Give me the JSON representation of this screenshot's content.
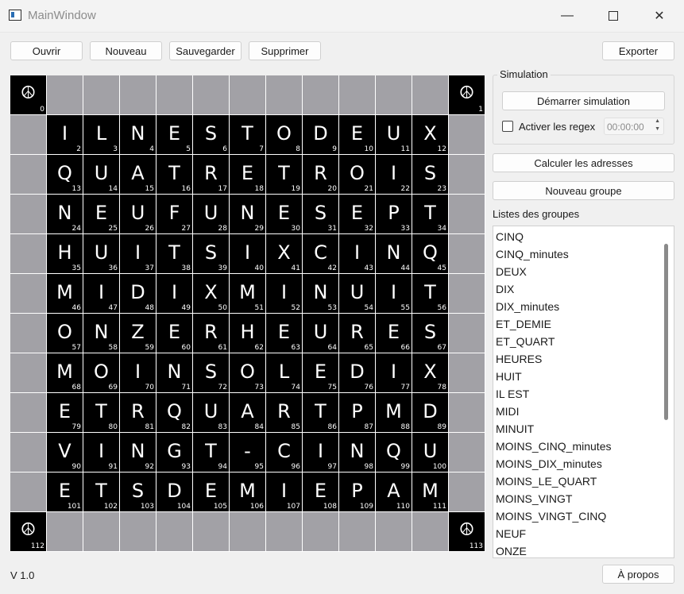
{
  "window": {
    "title": "MainWindow"
  },
  "toolbar": {
    "open_label": "Ouvrir",
    "new_label": "Nouveau",
    "save_label": "Sauvegarder",
    "delete_label": "Supprimer",
    "export_label": "Exporter"
  },
  "grid": {
    "corner_symbol": "☮",
    "corner_indices": [
      "0",
      "1",
      "112",
      "113"
    ],
    "rows": [
      [
        "I",
        "L",
        "N",
        "E",
        "S",
        "T",
        "O",
        "D",
        "E",
        "U",
        "X"
      ],
      [
        "Q",
        "U",
        "A",
        "T",
        "R",
        "E",
        "T",
        "R",
        "O",
        "I",
        "S"
      ],
      [
        "N",
        "E",
        "U",
        "F",
        "U",
        "N",
        "E",
        "S",
        "E",
        "P",
        "T"
      ],
      [
        "H",
        "U",
        "I",
        "T",
        "S",
        "I",
        "X",
        "C",
        "I",
        "N",
        "Q"
      ],
      [
        "M",
        "I",
        "D",
        "I",
        "X",
        "M",
        "I",
        "N",
        "U",
        "I",
        "T"
      ],
      [
        "O",
        "N",
        "Z",
        "E",
        "R",
        "H",
        "E",
        "U",
        "R",
        "E",
        "S"
      ],
      [
        "M",
        "O",
        "I",
        "N",
        "S",
        "O",
        "L",
        "E",
        "D",
        "I",
        "X"
      ],
      [
        "E",
        "T",
        "R",
        "Q",
        "U",
        "A",
        "R",
        "T",
        "P",
        "M",
        "D"
      ],
      [
        "V",
        "I",
        "N",
        "G",
        "T",
        "-",
        "C",
        "I",
        "N",
        "Q",
        "U"
      ],
      [
        "E",
        "T",
        "S",
        "D",
        "E",
        "M",
        "I",
        "E",
        "P",
        "A",
        "M"
      ]
    ],
    "start_index": 2
  },
  "simulation": {
    "group_title": "Simulation",
    "start_label": "Démarrer simulation",
    "regex_label": "Activer les regex",
    "regex_checked": false,
    "time_value": "00:00:00"
  },
  "actions": {
    "compute_label": "Calculer les adresses",
    "new_group_label": "Nouveau groupe"
  },
  "groups": {
    "title": "Listes des groupes",
    "items": [
      "CINQ",
      "CINQ_minutes",
      "DEUX",
      "DIX",
      "DIX_minutes",
      "ET_DEMIE",
      "ET_QUART",
      "HEURES",
      "HUIT",
      "IL EST",
      "MIDI",
      "MINUIT",
      "MOINS_CINQ_minutes",
      "MOINS_DIX_minutes",
      "MOINS_LE_QUART",
      "MOINS_VINGT",
      "MOINS_VINGT_CINQ",
      "NEUF",
      "ONZE"
    ]
  },
  "footer": {
    "version": "V 1.0",
    "about_label": "À propos"
  }
}
